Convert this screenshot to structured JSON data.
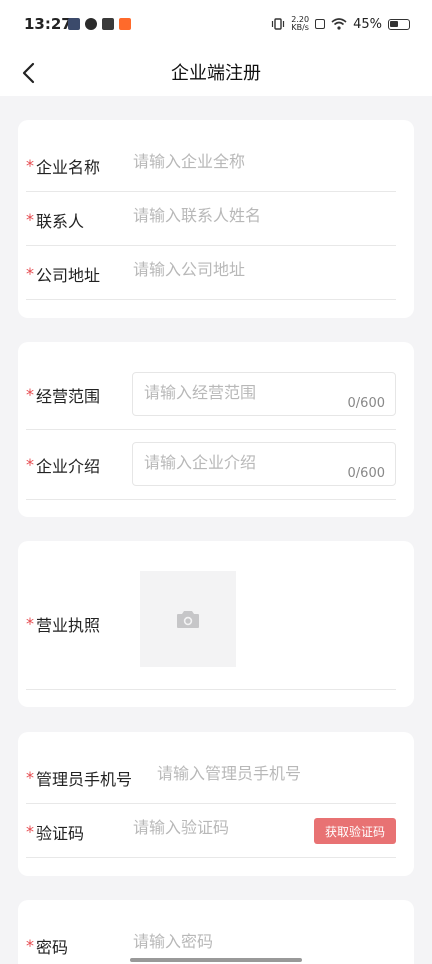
{
  "status_bar": {
    "time": "13:27",
    "net_speed_value": "2.20",
    "net_speed_unit": "KB/s",
    "battery": "45%"
  },
  "nav": {
    "title": "企业端注册"
  },
  "basic": {
    "company_name_label": "企业名称",
    "company_name_placeholder": "请输入企业全称",
    "contact_label": "联系人",
    "contact_placeholder": "请输入联系人姓名",
    "address_label": "公司地址",
    "address_placeholder": "请输入公司地址"
  },
  "business": {
    "scope_label": "经营范围",
    "scope_placeholder": "请输入经营范围",
    "scope_counter": "0/600",
    "intro_label": "企业介绍",
    "intro_placeholder": "请输入企业介绍",
    "intro_counter": "0/600"
  },
  "license": {
    "label": "营业执照"
  },
  "admin": {
    "phone_label": "管理员手机号",
    "phone_placeholder": "请输入管理员手机号",
    "code_label": "验证码",
    "code_placeholder": "请输入验证码",
    "get_code_label": "获取验证码"
  },
  "password": {
    "label": "密码",
    "placeholder": "请输入密码"
  },
  "required_mark": "*",
  "colors": {
    "accent_red": "#e5484d",
    "button_red": "#e87273",
    "background": "#f4f4f6"
  }
}
